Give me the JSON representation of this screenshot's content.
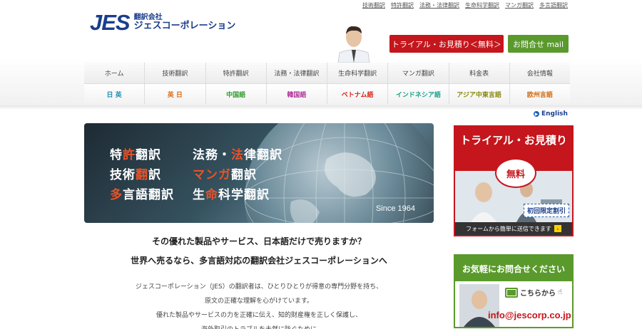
{
  "top_links": [
    "技術翻訳",
    "特許翻訳",
    "法務・法律翻訳",
    "生命科学翻訳",
    "マンガ翻訳",
    "多言語翻訳"
  ],
  "logo": {
    "main": "JES",
    "sub1": "翻訳会社",
    "sub2": "ジェスコーポレーション"
  },
  "header_buttons": {
    "trial": "トライアル・お見積り＜無料＞",
    "contact": "お問合せ mail"
  },
  "nav": {
    "row1": [
      "ホーム",
      "技術翻訳",
      "特許翻訳",
      "法務・法律翻訳",
      "生命科学翻訳",
      "マンガ翻訳",
      "料金表",
      "会社情報"
    ],
    "row2": [
      {
        "label": "日 英",
        "color": "#1a8fb4"
      },
      {
        "label": "英 日",
        "color": "#e06a10"
      },
      {
        "label": "中国語",
        "color": "#2e9a2e"
      },
      {
        "label": "韓国語",
        "color": "#b0309a"
      },
      {
        "label": "ベトナム語",
        "color": "#d9261c"
      },
      {
        "label": "インドネシア語",
        "color": "#1aa08a"
      },
      {
        "label": "アジア中東言語",
        "color": "#8a8a10"
      },
      {
        "label": "欧州言語",
        "color": "#d06a10"
      }
    ]
  },
  "english_link": "English",
  "banner": {
    "lines": [
      {
        "pre": "特",
        "hl": "許",
        "post": "翻訳"
      },
      {
        "pre": "法務・",
        "hl": "法",
        "post": "律翻訳"
      },
      {
        "pre": "技術",
        "hl": "翻",
        "post": "訳"
      },
      {
        "pre": "",
        "hl": "マンガ",
        "post": "翻訳"
      },
      {
        "pre": "",
        "hl": "多",
        "post": "言語翻訳"
      },
      {
        "pre": "生",
        "hl": "命",
        "post": "科学翻訳"
      }
    ],
    "since": "Since 1964"
  },
  "headline": {
    "line1": "その優れた製品やサービス、日本語だけで売りますか？",
    "line2": "世界へ売るなら、多言語対応の翻訳会社ジェスコーポレーションへ"
  },
  "body_lines": [
    "ジェスコーポレーション（JES）の翻訳者は、ひとりひとりが得意の専門分野を持ち、",
    "原文の正確な理解を心がけています。",
    "優れた製品やサービスの力を正確に伝え、知的財産権を正しく保護し、",
    "海外取引のトラブルを未然に防ぐために"
  ],
  "side_trial": {
    "title": "トライアル・お見積り",
    "free": "無料",
    "badge": "初回限定割引",
    "footer": "フォームから簡単に送信できます"
  },
  "side_contact": {
    "title": "お気軽にお問合せください",
    "cta": "こちらから",
    "email": "info@jescorp.co.jp"
  }
}
